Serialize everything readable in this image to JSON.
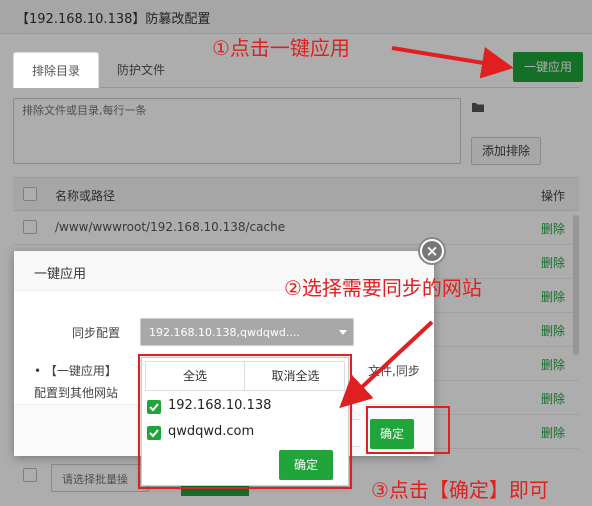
{
  "window": {
    "title": "【192.168.10.138】防篡改配置"
  },
  "tabs": [
    {
      "label": "排除目录"
    },
    {
      "label": "防护文件"
    }
  ],
  "exclude": {
    "placeholder": "排除文件或目录,每行一条",
    "add_button": "添加排除",
    "apply_button": "一键应用"
  },
  "table": {
    "headers": {
      "name": "名称或路径",
      "op": "操作"
    },
    "rows": [
      {
        "path": "/www/wwwroot/192.168.10.138/cache",
        "action": "删除"
      },
      {
        "path": "",
        "action": "删除"
      },
      {
        "path": "",
        "action": "删除"
      },
      {
        "path": "",
        "action": "删除"
      },
      {
        "path": "",
        "action": "删除"
      },
      {
        "path": "",
        "action": "删除"
      },
      {
        "path": "",
        "action": "删除"
      }
    ]
  },
  "bottom": {
    "select_placeholder": "请选择批量操"
  },
  "dialog": {
    "title": "一键应用",
    "sync_label": "同步配置",
    "select_value": "192.168.10.138,qwdqwd....",
    "desc_line1": "•  【一键应用】",
    "desc_line1_tail": "文件,同步",
    "desc_line2": "配置到其他网站",
    "confirm": "确定",
    "close": "×"
  },
  "dropdown": {
    "select_all": "全选",
    "deselect_all": "取消全选",
    "sites": [
      {
        "name": "192.168.10.138",
        "checked": true
      },
      {
        "name": "qwdqwd.com",
        "checked": true
      }
    ],
    "confirm": "确定"
  },
  "annotations": {
    "step1": "①点击一键应用",
    "step2": "②选择需要同步的网站",
    "step3": "③点击【确定】即可"
  },
  "colors": {
    "accent": "#20a53a",
    "annotation": "#e02020"
  }
}
